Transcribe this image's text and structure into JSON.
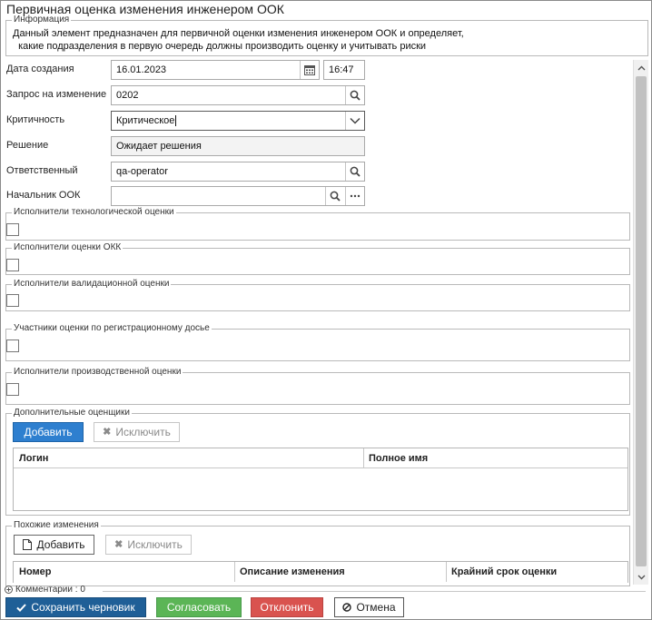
{
  "window": {
    "title": "Первичная оценка изменения инженером ООК"
  },
  "info": {
    "legend": "Информация",
    "lines": [
      "Данный элемент предназначен для первичной оценки изменения инженером ООК и определяет,",
      "  какие подразделения в первую очередь должны производить оценку и учитывать риски"
    ]
  },
  "fields": {
    "created": {
      "label": "Дата создания",
      "date": "16.01.2023",
      "time": "16:47"
    },
    "change_request": {
      "label": "Запрос на изменение",
      "value": "0202"
    },
    "criticality": {
      "label": "Критичность",
      "value": "Критическое"
    },
    "decision": {
      "label": "Решение",
      "value": "Ожидает решения"
    },
    "responsible": {
      "label": "Ответственный",
      "value": "qa-operator"
    },
    "ook_head": {
      "label": "Начальник ООК",
      "value": ""
    }
  },
  "groups": {
    "tech": "Исполнители технологической оценки",
    "okk": "Исполнители оценки ОКК",
    "validation": "Исполнители валидационной оценки",
    "reg_dossier": "Участники оценки по регистрационному досье",
    "production": "Исполнители производственной оценки"
  },
  "additional": {
    "legend": "Дополнительные оценщики",
    "add_label": "Добавить",
    "exclude_label": "Исключить",
    "columns": [
      "Логин",
      "Полное имя"
    ]
  },
  "similar": {
    "legend": "Похожие изменения",
    "add_label": "Добавить",
    "exclude_label": "Исключить",
    "columns": [
      "Номер",
      "Описание изменения",
      "Крайний срок оценки"
    ]
  },
  "comments": {
    "label": "Комментарии : 0"
  },
  "footer": {
    "save": "Сохранить черновик",
    "approve": "Согласовать",
    "reject": "Отклонить",
    "cancel": "Отмена"
  },
  "colors": {
    "primary": "#2e7fcf",
    "save": "#1f5f97",
    "approve": "#5bb556",
    "reject": "#d9534f"
  }
}
